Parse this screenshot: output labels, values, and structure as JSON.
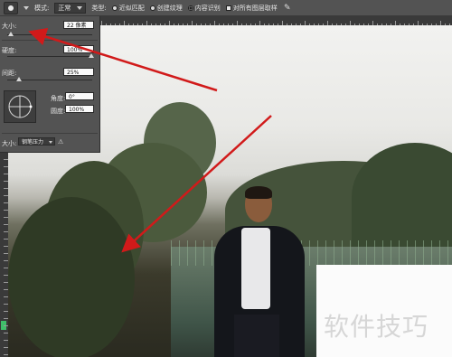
{
  "options_bar": {
    "mode_label": "模式:",
    "mode_value": "正常",
    "type_label": "类型:",
    "type_options": [
      "近似匹配",
      "创建纹理",
      "内容识别"
    ],
    "type_selected": "内容识别",
    "sample_all_layers": "对所有图层取样"
  },
  "brush_panel": {
    "size_label": "大小:",
    "size_value": "22 像素",
    "hardness_label": "硬度:",
    "hardness_value": "100%",
    "spacing_label": "间距:",
    "spacing_value": "25%",
    "angle_label": "角度:",
    "angle_value": "0°",
    "roundness_label": "圆度:",
    "roundness_value": "100%",
    "pressure_label": "大小:",
    "pressure_value": "钢笔压力"
  },
  "watermark": "软件技巧",
  "colors": {
    "annotation_arrow": "#d11a1a",
    "ui_panel": "#535353",
    "accent": "#3fbf6a"
  }
}
